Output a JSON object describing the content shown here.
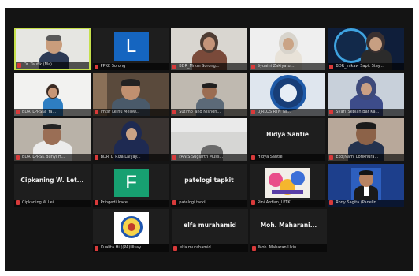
{
  "tiles": [
    {
      "label": "Dr. Taufik (Ma)..."
    },
    {
      "label": "PPKC Sorong",
      "letter": "L",
      "letter_color": "#1565c0"
    },
    {
      "label": "BDR_Mrkm Sorong..."
    },
    {
      "label": "Syuaini Zakiyatur..."
    },
    {
      "label": "BDR_Inikaw Sapit Stay..."
    },
    {
      "label": "BDR_LPPSKe Ya..."
    },
    {
      "label": "lmtsr Lelhu Melow..."
    },
    {
      "label": "Sutimo_and Nisnon..."
    },
    {
      "label": "UJRLOS RTN_Ni..."
    },
    {
      "label": "Syari_Sebiah Bar Ka..."
    },
    {
      "label": "BDR_LPPSK Bunyi H..."
    },
    {
      "label": "BDR_L_Riza Lalyay..."
    },
    {
      "label": "FANIS Sugiarth Muss..."
    },
    {
      "label": "Hidya Santie",
      "name": "Hidya Santie"
    },
    {
      "label": "Eko(Nami Lorikhura..."
    },
    {
      "label": "Cipkaning W Lei...",
      "name": "Cipkaning W. Let..."
    },
    {
      "label": "Pringedi Irace...",
      "letter": "F",
      "letter_color": "#17a071"
    },
    {
      "label": "patelogi tarkil",
      "name": "patelogi tapkit"
    },
    {
      "label": "Rini Ardian_LPTK..."
    },
    {
      "label": "Rony Sagita (Panelin..."
    },
    {
      "label": "Kualita Hi ((PA)Ulsay..."
    },
    {
      "label": "elfa murahamid",
      "name": "elfa murahamid"
    },
    {
      "label": "Moh. Maharan Ukin...",
      "name": "Moh. Maharani..."
    }
  ],
  "colors": {
    "active_border": "#c6e04c",
    "muted_icon": "#d83a3a",
    "frame_bg": "#141414"
  }
}
